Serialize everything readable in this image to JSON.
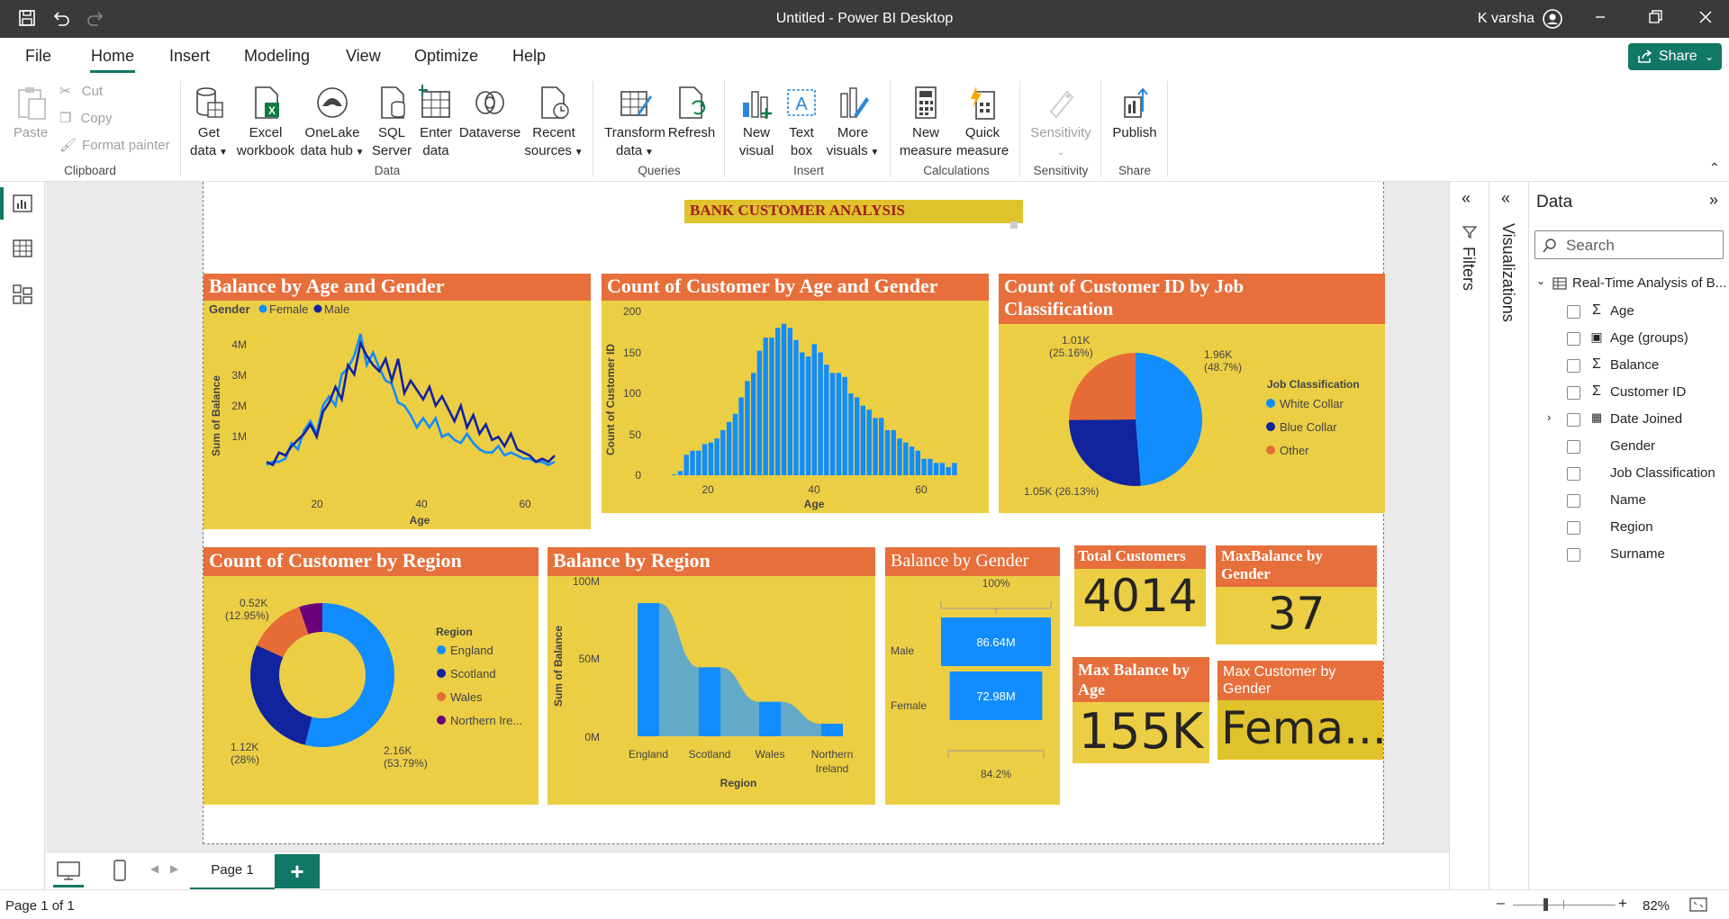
{
  "window": {
    "title": "Untitled - Power BI Desktop",
    "user": "K varsha"
  },
  "menu": {
    "file": "File",
    "home": "Home",
    "insert": "Insert",
    "modeling": "Modeling",
    "view": "View",
    "optimize": "Optimize",
    "help": "Help",
    "share": "Share"
  },
  "ribbon": {
    "paste": "Paste",
    "cut": "Cut",
    "copy": "Copy",
    "format_painter": "Format painter",
    "get_data": [
      "Get",
      "data"
    ],
    "excel": [
      "Excel",
      "workbook"
    ],
    "onelake": [
      "OneLake",
      "data hub"
    ],
    "sql": [
      "SQL",
      "Server"
    ],
    "enter": [
      "Enter",
      "data"
    ],
    "dataverse": "Dataverse",
    "recent": [
      "Recent",
      "sources"
    ],
    "transform": [
      "Transform",
      "data"
    ],
    "refresh": "Refresh",
    "new_visual": [
      "New",
      "visual"
    ],
    "text_box": [
      "Text",
      "box"
    ],
    "more_visuals": [
      "More",
      "visuals"
    ],
    "new_measure": [
      "New",
      "measure"
    ],
    "quick_measure": [
      "Quick",
      "measure"
    ],
    "sensitivity": "Sensitivity",
    "publish": "Publish",
    "groups": {
      "clipboard": "Clipboard",
      "data": "Data",
      "queries": "Queries",
      "insert": "Insert",
      "calculations": "Calculations",
      "sensitivity": "Sensitivity",
      "share": "Share"
    }
  },
  "report": {
    "title": "BANK CUSTOMER ANALYSIS"
  },
  "visuals": {
    "balance_age_gender": {
      "title": "Balance by Age and Gender",
      "legend_title": "Gender",
      "legend": [
        "Female",
        "Male"
      ],
      "ylabel": "Sum of Balance",
      "xlabel": "Age",
      "yticks": [
        "4M",
        "3M",
        "2M",
        "1M"
      ],
      "xticks": [
        "20",
        "40",
        "60"
      ]
    },
    "count_age_gender": {
      "title": "Count of Customer by Age and Gender",
      "ylabel": "Count of Customer ID",
      "xlabel": "Age",
      "yticks": [
        "200",
        "150",
        "100",
        "50",
        "0"
      ],
      "xticks": [
        "20",
        "40",
        "60"
      ]
    },
    "job_class": {
      "title_line1": "Count of Customer ID by Job",
      "title_line2": "Classification",
      "legend_title": "Job Classification",
      "legend": [
        "White Collar",
        "Blue Collar",
        "Other"
      ],
      "labels": [
        [
          "1.96K",
          "(48.7%)"
        ],
        [
          "1.05K (26.13%)"
        ],
        [
          "1.01K",
          "(25.16%)"
        ]
      ]
    },
    "region_count": {
      "title": "Count of Customer by Region",
      "legend_title": "Region",
      "legend": [
        "England",
        "Scotland",
        "Wales",
        "Northern Ire..."
      ],
      "labels": [
        [
          "2.16K",
          "(53.79%)"
        ],
        [
          "1.12K",
          "(28%)"
        ],
        [
          "0.52K",
          "(12.95%)"
        ]
      ]
    },
    "balance_region": {
      "title": "Balance by Region",
      "ylabel": "Sum of Balance",
      "xlabel": "Region",
      "yticks": [
        "100M",
        "50M",
        "0M"
      ],
      "xticks": [
        "England",
        "Scotland",
        "Wales",
        "Northern",
        "Ireland"
      ]
    },
    "balance_gender": {
      "title": "Balance by Gender",
      "top_pct": "100%",
      "bottom_pct": "84.2%",
      "male_label": "Male",
      "female_label": "Female",
      "male_val": "86.64M",
      "female_val": "72.98M"
    },
    "total_customers": {
      "title": "Total Customers",
      "value": "4014"
    },
    "max_balance_gender": {
      "title_line1": "MaxBalance by",
      "title_line2": "Gender",
      "value": "37"
    },
    "max_balance_age": {
      "title_line1": "Max Balance by",
      "title_line2": "Age",
      "value": "155K"
    },
    "max_customer_gender": {
      "title_line1": "Max Customer by",
      "title_line2": "Gender",
      "value": "Fema..."
    }
  },
  "chart_data": [
    {
      "type": "line",
      "title": "Balance by Age and Gender",
      "xlabel": "Age",
      "ylabel": "Sum of Balance",
      "ylim": [
        0,
        4500000
      ],
      "xlim": [
        18,
        64
      ],
      "x": [
        18,
        19,
        20,
        21,
        22,
        23,
        24,
        25,
        26,
        27,
        28,
        29,
        30,
        31,
        32,
        33,
        34,
        35,
        36,
        37,
        38,
        39,
        40,
        41,
        42,
        43,
        44,
        45,
        46,
        47,
        48,
        49,
        50,
        51,
        52,
        53,
        54,
        55,
        56,
        57,
        58,
        59,
        60,
        61,
        62,
        63,
        64
      ],
      "series": [
        {
          "name": "Female",
          "values": [
            0.1,
            0.2,
            0.2,
            0.3,
            0.8,
            0.6,
            1.2,
            1.5,
            1.1,
            2.0,
            2.3,
            2.0,
            3.0,
            3.2,
            3.6,
            4.3,
            3.3,
            3.7,
            3.2,
            2.8,
            2.7,
            2.1,
            2.0,
            1.7,
            1.3,
            1.6,
            1.3,
            1.6,
            1.0,
            1.1,
            0.9,
            0.8,
            1.1,
            0.8,
            0.6,
            0.5,
            0.5,
            0.7,
            0.4,
            0.5,
            0.4,
            0.3,
            0.3,
            0.2,
            0.2,
            0.1,
            0.2
          ]
        },
        {
          "name": "Male",
          "values": [
            0.2,
            0.1,
            0.5,
            0.4,
            0.7,
            0.9,
            1.1,
            1.4,
            1.0,
            1.8,
            2.1,
            2.6,
            2.2,
            3.3,
            3.0,
            4.0,
            3.6,
            3.3,
            3.1,
            3.5,
            2.8,
            3.5,
            2.4,
            2.8,
            2.5,
            2.2,
            2.6,
            2.0,
            2.3,
            1.9,
            1.5,
            2.0,
            1.3,
            1.7,
            1.1,
            1.4,
            0.9,
            1.0,
            0.7,
            1.1,
            0.6,
            0.5,
            0.4,
            0.2,
            0.3,
            0.2,
            0.4
          ]
        }
      ]
    },
    {
      "type": "bar",
      "title": "Count of Customer by Age and Gender",
      "xlabel": "Age",
      "ylabel": "Count of Customer ID",
      "ylim": [
        0,
        200
      ],
      "x": [
        18,
        19,
        20,
        21,
        22,
        23,
        24,
        25,
        26,
        27,
        28,
        29,
        30,
        31,
        32,
        33,
        34,
        35,
        36,
        37,
        38,
        39,
        40,
        41,
        42,
        43,
        44,
        45,
        46,
        47,
        48,
        49,
        50,
        51,
        52,
        53,
        54,
        55,
        56,
        57,
        58,
        59,
        60,
        61,
        62,
        63,
        64
      ],
      "values": [
        1,
        5,
        25,
        30,
        30,
        38,
        40,
        45,
        55,
        65,
        75,
        95,
        115,
        125,
        152,
        168,
        168,
        180,
        185,
        180,
        165,
        150,
        145,
        160,
        150,
        135,
        125,
        125,
        120,
        100,
        95,
        85,
        80,
        70,
        70,
        55,
        55,
        45,
        40,
        35,
        30,
        20,
        20,
        15,
        15,
        10,
        15
      ]
    },
    {
      "type": "pie",
      "title": "Count of Customer ID by Job Classification",
      "categories": [
        "White Collar",
        "Blue Collar",
        "Other"
      ],
      "values": [
        1960,
        1050,
        1010
      ],
      "percent": [
        48.7,
        26.13,
        25.16
      ]
    },
    {
      "type": "pie",
      "title": "Count of Customer by Region",
      "categories": [
        "England",
        "Scotland",
        "Wales",
        "Northern Ireland"
      ],
      "values": [
        2160,
        1120,
        520,
        210
      ],
      "percent": [
        53.79,
        28,
        12.95,
        5.26
      ]
    },
    {
      "type": "area",
      "title": "Balance by Region",
      "xlabel": "Region",
      "ylabel": "Sum of Balance",
      "categories": [
        "England",
        "Scotland",
        "Wales",
        "Northern Ireland"
      ],
      "values": [
        85,
        44,
        22,
        8
      ],
      "ylim": [
        0,
        100
      ]
    },
    {
      "type": "bar",
      "title": "Balance by Gender",
      "categories": [
        "Male",
        "Female"
      ],
      "values": [
        86.64,
        72.98
      ]
    }
  ],
  "data_pane": {
    "title": "Data",
    "search_placeholder": "Search",
    "table": "Real-Time Analysis of B...",
    "fields": [
      "Age",
      "Age (groups)",
      "Balance",
      "Customer ID",
      "Date Joined",
      "Gender",
      "Job Classification",
      "Name",
      "Region",
      "Surname"
    ]
  },
  "side_tabs": {
    "filters": "Filters",
    "visualizations": "Visualizations"
  },
  "pages": {
    "page1": "Page 1"
  },
  "status": {
    "page_info": "Page 1 of 1",
    "zoom": "82%"
  },
  "colors": {
    "card": "#ecce45",
    "header": "#e66f3b",
    "accent": "#117865",
    "series1": "#118dff",
    "series2": "#12239e",
    "series3": "#e66c37",
    "series4": "#6b007b"
  }
}
